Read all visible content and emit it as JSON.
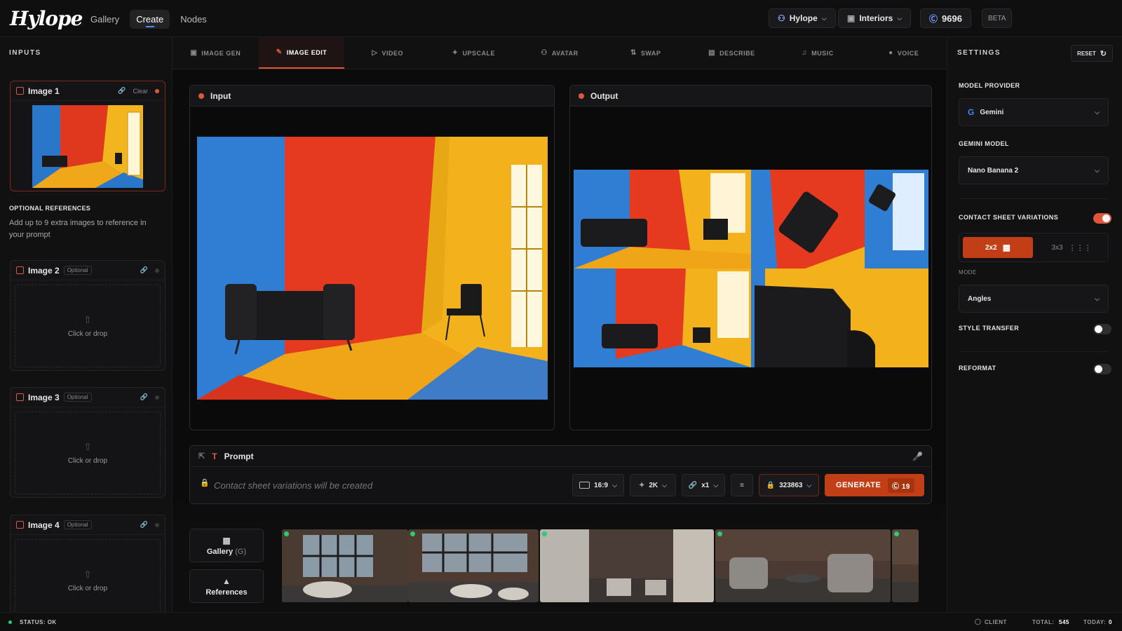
{
  "app": {
    "logo": "Hylope"
  },
  "topbar": {
    "nav": [
      "Gallery",
      "Create",
      "Nodes"
    ],
    "workspace": "Hylope",
    "project": "Interiors",
    "credits": "9696",
    "beta": "BETA"
  },
  "inputs": {
    "title": "INPUTS",
    "image1": {
      "label": "Image 1",
      "clear": "Clear"
    },
    "optional_title": "OPTIONAL REFERENCES",
    "optional_desc": "Add up to 9 extra images to reference in your prompt",
    "refs": [
      {
        "label": "Image 2",
        "badge": "Optional",
        "drop": "Click or drop"
      },
      {
        "label": "Image 3",
        "badge": "Optional",
        "drop": "Click or drop"
      },
      {
        "label": "Image 4",
        "badge": "Optional",
        "drop": "Click or drop"
      }
    ]
  },
  "tabs": [
    "IMAGE GEN",
    "IMAGE EDIT",
    "VIDEO",
    "UPSCALE",
    "AVATAR",
    "SWAP",
    "DESCRIBE",
    "MUSIC",
    "VOICE"
  ],
  "active_tab": "IMAGE EDIT",
  "canvas": {
    "input_label": "Input",
    "output_label": "Output"
  },
  "prompt": {
    "label": "Prompt",
    "placeholder": "Contact sheet variations will be created",
    "aspect": "16:9",
    "resolution": "2K",
    "count": "x1",
    "seed": "323863",
    "generate": "GENERATE",
    "cost": "19"
  },
  "filmstrip": {
    "gallery": "Gallery",
    "gallery_shortcut": "(G)",
    "references": "References"
  },
  "settings": {
    "title": "SETTINGS",
    "reset": "RESET",
    "model_provider_label": "MODEL PROVIDER",
    "model_provider": "Gemini",
    "gemini_model_label": "GEMINI MODEL",
    "gemini_model": "Nano Banana 2",
    "contact_sheet_label": "CONTACT SHEET VARIATIONS",
    "contact_sheet_on": true,
    "grid_options": [
      "2x2",
      "3x3"
    ],
    "mode_label": "MODE",
    "mode": "Angles",
    "style_transfer_label": "STYLE TRANSFER",
    "style_transfer_on": false,
    "reformat_label": "REFORMAT",
    "reformat_on": false
  },
  "status": {
    "status": "STATUS: OK",
    "client": "CLIENT",
    "total_label": "TOTAL:",
    "total": "545",
    "today_label": "TODAY:",
    "today": "0"
  },
  "colors": {
    "accent": "#e0563b",
    "generate": "#c23e17",
    "ok": "#2ecc71",
    "bg": "#0d0d0e"
  },
  "icons": [
    "user-icon",
    "folder-icon",
    "credit-icon",
    "reset-icon",
    "image-icon",
    "link-icon",
    "upload-icon",
    "microphone-icon",
    "lock-icon",
    "grid-icon",
    "chevron-down-icon",
    "google-icon"
  ]
}
